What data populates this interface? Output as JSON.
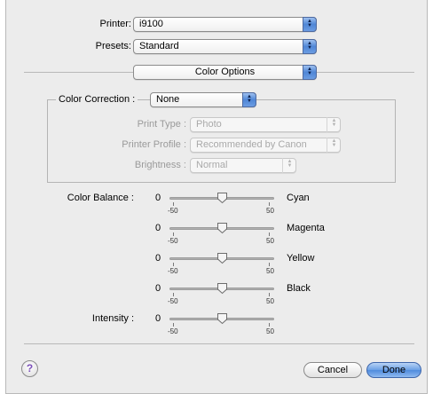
{
  "printer": {
    "label": "Printer:",
    "value": "i9100"
  },
  "presets": {
    "label": "Presets:",
    "value": "Standard"
  },
  "panel_selector": {
    "value": "Color Options"
  },
  "color_correction": {
    "label": "Color Correction :",
    "value": "None",
    "print_type": {
      "label": "Print Type :",
      "value": "Photo"
    },
    "printer_profile": {
      "label": "Printer Profile :",
      "value": "Recommended by Canon"
    },
    "brightness": {
      "label": "Brightness :",
      "value": "Normal"
    }
  },
  "color_balance": {
    "label": "Color Balance :",
    "sliders": [
      {
        "name": "Cyan",
        "value": 0,
        "min": -50,
        "max": 50
      },
      {
        "name": "Magenta",
        "value": 0,
        "min": -50,
        "max": 50
      },
      {
        "name": "Yellow",
        "value": 0,
        "min": -50,
        "max": 50
      },
      {
        "name": "Black",
        "value": 0,
        "min": -50,
        "max": 50
      }
    ]
  },
  "intensity": {
    "label": "Intensity :",
    "value": 0,
    "min": -50,
    "max": 50
  },
  "buttons": {
    "help": "?",
    "cancel": "Cancel",
    "done": "Done"
  },
  "colors": {
    "default_button": "#5b93e0",
    "popup_arrow": "#4f86d6",
    "dialog_bg": "#ececec",
    "help_mark": "#7b4fb9"
  }
}
